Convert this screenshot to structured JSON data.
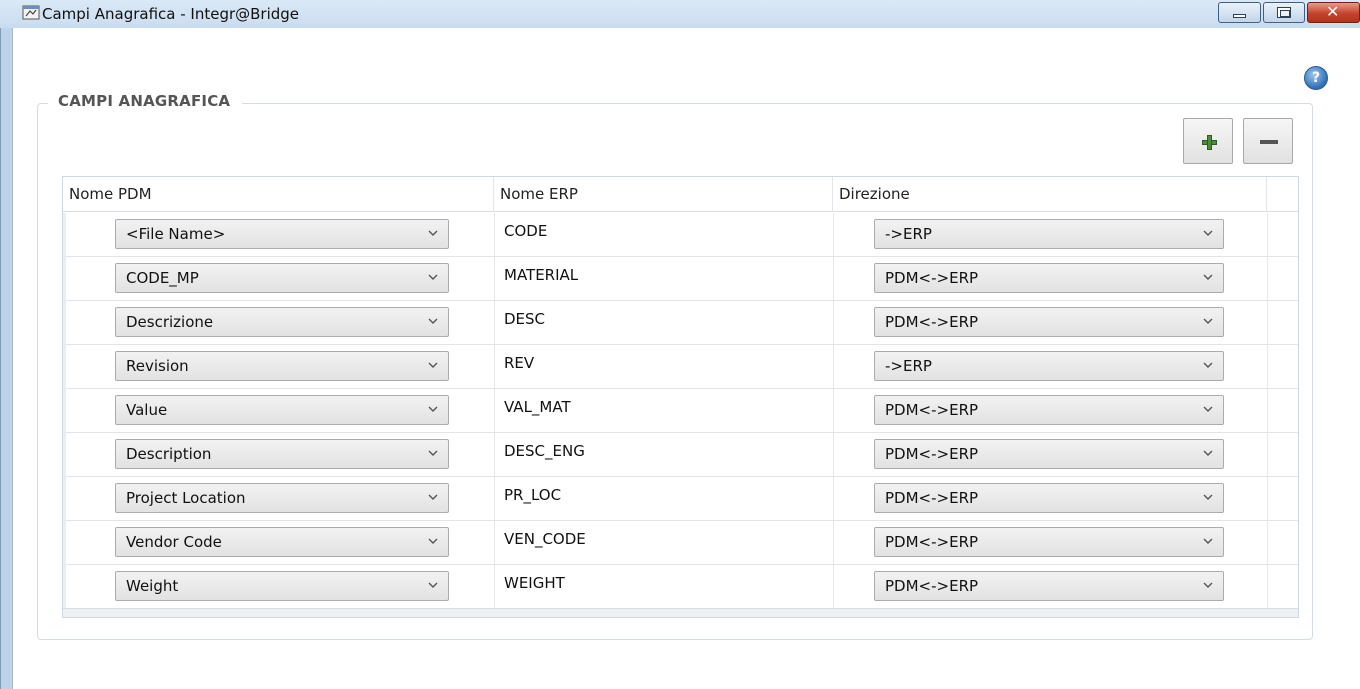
{
  "window": {
    "title": "Campi Anagrafica - Integr@Bridge",
    "icon": "app-window-icon"
  },
  "help": {
    "icon": "help-icon",
    "glyph": "?"
  },
  "group": {
    "title": "CAMPI ANAGRAFICA"
  },
  "toolbar": {
    "add_icon": "plus-icon",
    "remove_icon": "minus-icon"
  },
  "grid": {
    "columns": [
      "Nome PDM",
      "Nome ERP",
      "Direzione"
    ],
    "rows": [
      {
        "pdm": "<File Name>",
        "erp": "CODE",
        "direzione": "->ERP"
      },
      {
        "pdm": "CODE_MP",
        "erp": "MATERIAL",
        "direzione": "PDM<->ERP"
      },
      {
        "pdm": "Descrizione",
        "erp": "DESC",
        "direzione": "PDM<->ERP"
      },
      {
        "pdm": "Revision",
        "erp": "REV",
        "direzione": "->ERP"
      },
      {
        "pdm": "Value",
        "erp": "VAL_MAT",
        "direzione": "PDM<->ERP"
      },
      {
        "pdm": "Description",
        "erp": "DESC_ENG",
        "direzione": "PDM<->ERP"
      },
      {
        "pdm": "Project Location",
        "erp": "PR_LOC",
        "direzione": "PDM<->ERP"
      },
      {
        "pdm": "Vendor Code",
        "erp": "VEN_CODE",
        "direzione": "PDM<->ERP"
      },
      {
        "pdm": "Weight",
        "erp": "WEIGHT",
        "direzione": "PDM<->ERP"
      }
    ]
  },
  "colors": {
    "title_bg": "#c9dcef",
    "close_red": "#c4432c",
    "plus_green": "#4f8c3a"
  }
}
